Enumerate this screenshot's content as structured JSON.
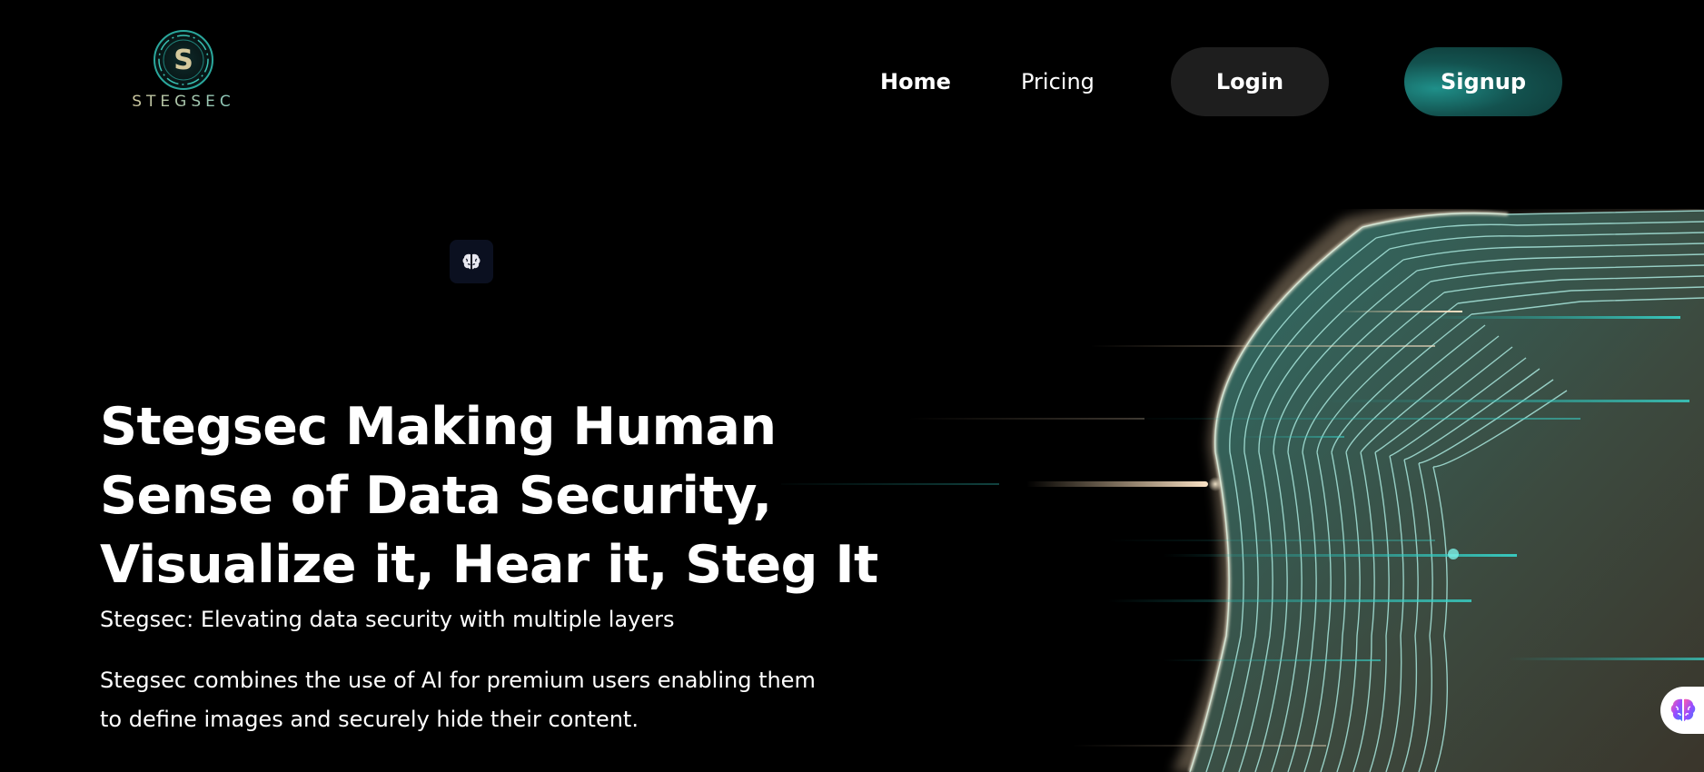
{
  "header": {
    "logo_text": "STEGSEC",
    "logo_letter": "S",
    "nav": {
      "home": "Home",
      "pricing": "Pricing",
      "login": "Login",
      "signup": "Signup"
    }
  },
  "hero": {
    "badge_icon": "brain-icon",
    "title_lines": [
      "Stegsec Making Human",
      "Sense of Data Security,",
      "Visualize it, Hear it, Steg It"
    ],
    "subtitle": "Stegsec: Elevating data security with multiple layers",
    "description_lines": [
      "Stegsec combines the use of AI for premium users enabling them",
      "to define images and securely hide their content."
    ]
  },
  "illustration": {
    "icon": "wireframe-head-illustration"
  },
  "floating_widget": {
    "icon": "colorful-brain-icon"
  },
  "colors": {
    "background": "#000000",
    "accent_teal": "#1f8f89",
    "login_bg": "#1e1e1e",
    "text": "#ffffff"
  }
}
